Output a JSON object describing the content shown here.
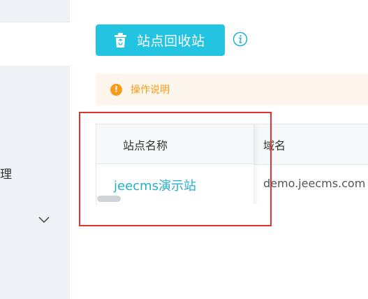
{
  "sidebar": {
    "menu_item_partial": "管理"
  },
  "toolbar": {
    "recycle_button_label": "站点回收站"
  },
  "notice": {
    "text": "操作说明",
    "icon_glyph": "!"
  },
  "table": {
    "columns": [
      "站点名称",
      "域名"
    ],
    "rows": [
      {
        "name": "jeecms演示站",
        "domain": "demo.jeecms.com"
      }
    ]
  },
  "colors": {
    "primary": "#22c4e1",
    "link": "#22b0cd",
    "warning": "#f79b18",
    "warning_bg": "#fdf6ec",
    "highlight": "#e5302f"
  },
  "icons": {
    "recycle_button": "recycle-bin-icon",
    "info": "info-icon",
    "notice": "warning-icon",
    "sidebar_expand": "chevron-down-icon"
  }
}
